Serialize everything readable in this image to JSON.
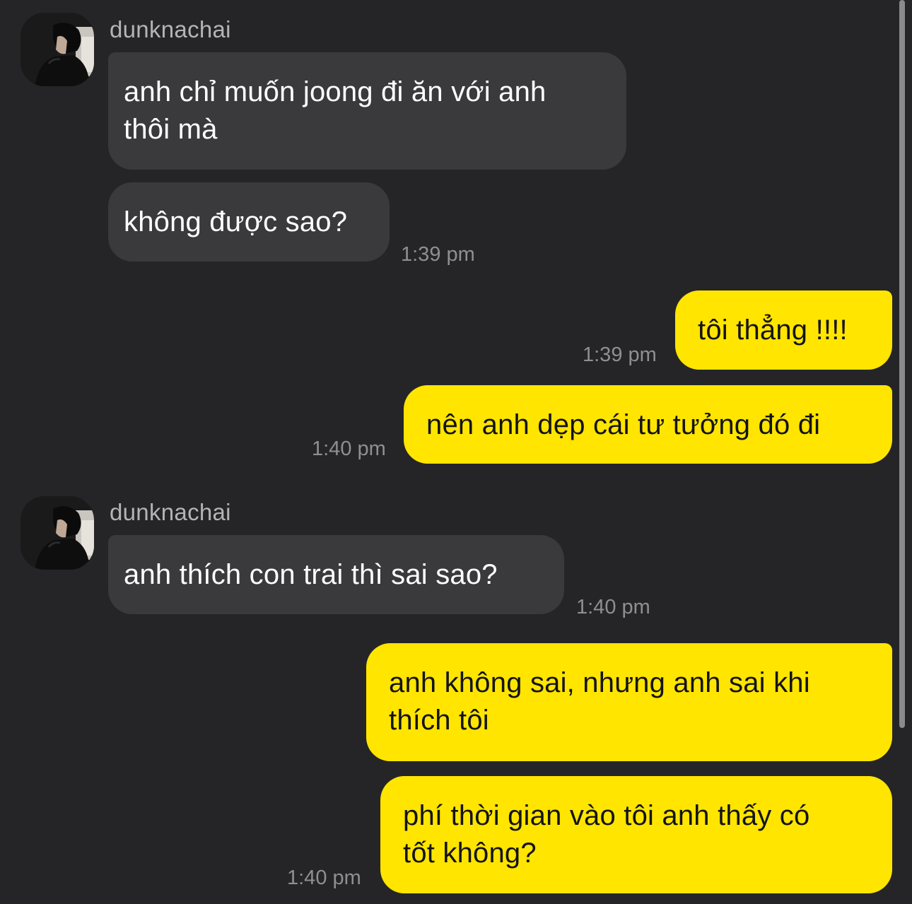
{
  "colors": {
    "background": "#252527",
    "incoming_bubble": "#3a3a3c",
    "outgoing_bubble": "#ffe500",
    "timestamp": "#8f8f92",
    "sender_name": "#b4b4b6"
  },
  "icons": {
    "avatar": "contact-profile-photo"
  },
  "messages": {
    "group1": {
      "sender": "dunknachai",
      "m1": {
        "line1": "anh chỉ muốn joong đi ăn với anh",
        "line2": "thôi mà"
      },
      "m2": {
        "text": "không được sao?"
      },
      "time": "1:39 pm"
    },
    "out1": {
      "m1": {
        "text": "tôi thẳng !!!!"
      },
      "time1": "1:39 pm",
      "m2": {
        "text": "nên anh dẹp cái tư tưởng đó đi"
      },
      "time2": "1:40 pm"
    },
    "group2": {
      "sender": "dunknachai",
      "m1": {
        "text": "anh thích con trai thì sai sao?"
      },
      "time": "1:40 pm"
    },
    "out2": {
      "m1": {
        "line1": "anh không sai, nhưng anh sai khi",
        "line2": "thích tôi"
      },
      "m2": {
        "line1": "phí thời gian vào tôi anh thấy có",
        "line2": "tốt không?"
      },
      "time": "1:40 pm"
    }
  }
}
